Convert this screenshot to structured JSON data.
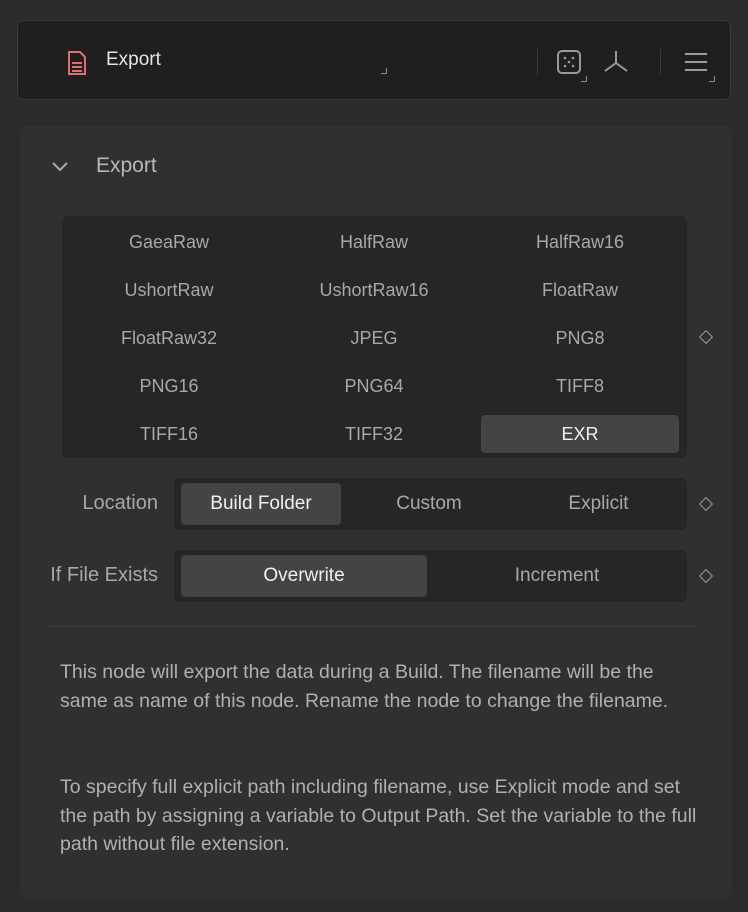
{
  "header": {
    "title": "Export",
    "icons": [
      "file-icon",
      "grid-dots-icon",
      "axis-icon",
      "menu-icon"
    ]
  },
  "section": {
    "title": "Export",
    "formats": [
      "GaeaRaw",
      "HalfRaw",
      "HalfRaw16",
      "UshortRaw",
      "UshortRaw16",
      "FloatRaw",
      "FloatRaw32",
      "JPEG",
      "PNG8",
      "PNG16",
      "PNG64",
      "TIFF8",
      "TIFF16",
      "TIFF32",
      "EXR"
    ],
    "selected_format": "EXR"
  },
  "location": {
    "label": "Location",
    "options": [
      "Build Folder",
      "Custom",
      "Explicit"
    ],
    "selected": "Build Folder"
  },
  "if_file_exists": {
    "label": "If File Exists",
    "options": [
      "Overwrite",
      "Increment"
    ],
    "selected": "Overwrite"
  },
  "description": {
    "paragraph1": "This node will export the data during a Build. The filename will be the same as name of this node. Rename the node to change the filename.",
    "paragraph2": "To specify full explicit path including filename, use Explicit mode and set the path by assigning a variable to Output Path. Set the variable to the full path without file extension."
  },
  "colors": {
    "accent_icon": "#e06c75",
    "background": "#2b2b2b",
    "panel": "#303030",
    "selected": "#444444"
  }
}
